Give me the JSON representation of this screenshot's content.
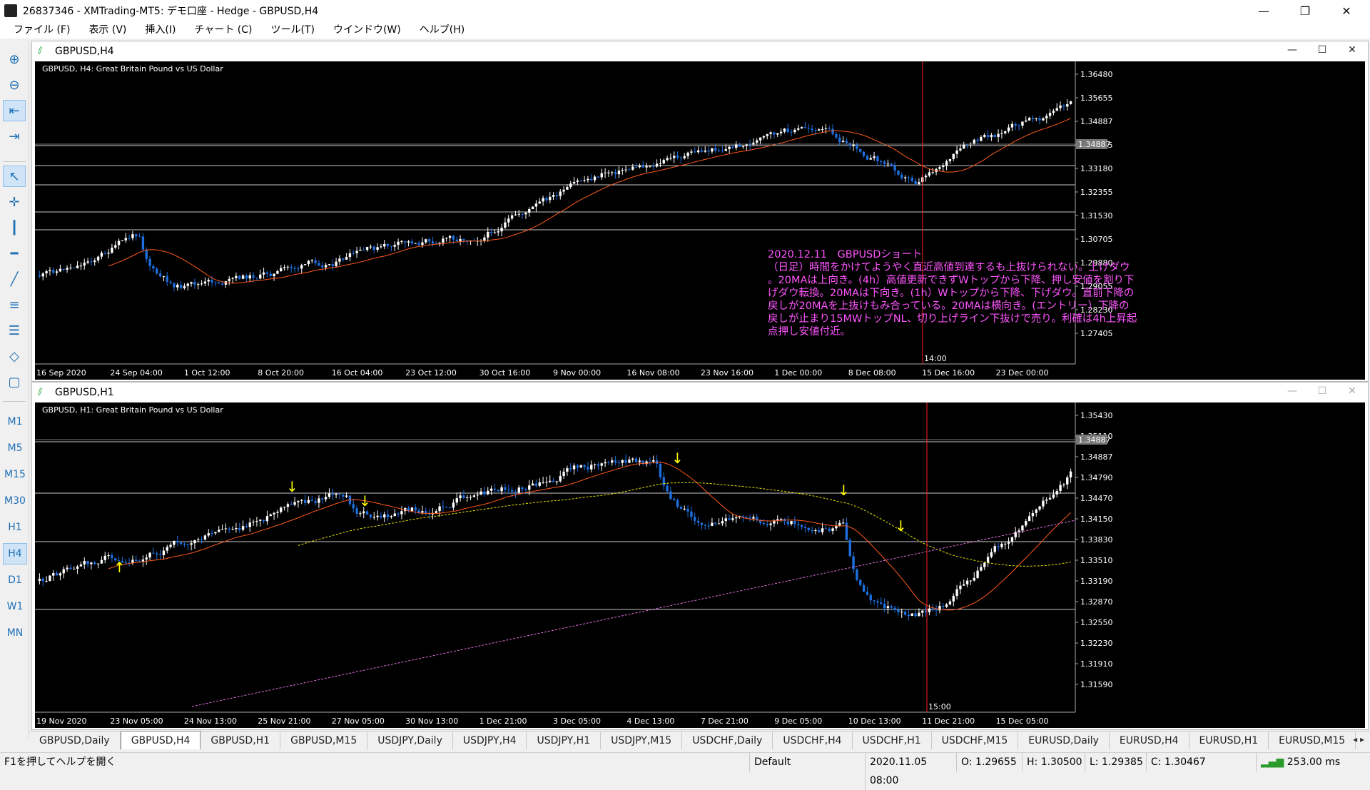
{
  "window": {
    "title": "26837346 - XMTrading-MT5: デモ口座 - Hedge - GBPUSD,H4",
    "controls": [
      "—",
      "❐",
      "✕"
    ]
  },
  "menu": [
    "ファイル (F)",
    "表示 (V)",
    "挿入(I)",
    "チャート (C)",
    "ツール(T)",
    "ウインドウ(W)",
    "ヘルプ(H)"
  ],
  "toolbar": {
    "tools": [
      "zoom-in-icon",
      "zoom-out-icon",
      "chart-shift-icon",
      "autoscroll-icon",
      "cursor-icon",
      "crosshair-icon",
      "vertical-line-icon",
      "horizontal-line-icon",
      "trend-line-icon",
      "channel-icon",
      "fibonacci-icon",
      "shapes-icon",
      "select-icon"
    ],
    "timeframes": [
      "M1",
      "M5",
      "M15",
      "M30",
      "H1",
      "H4",
      "D1",
      "W1",
      "MN"
    ],
    "active_timeframe": "H4"
  },
  "charts": [
    {
      "window_title": "GBPUSD,H4",
      "plot_label": "GBPUSD, H4:  Great Britain Pound vs US Dollar",
      "price_ticks": [
        "1.36480",
        "1.35655",
        "1.34887",
        "1.34005",
        "1.33180",
        "1.32355",
        "1.31530",
        "1.30705",
        "1.29880",
        "1.29055",
        "1.28230",
        "1.27405"
      ],
      "current_price": "1.34887",
      "time_ticks": [
        "16 Sep 2020",
        "24 Sep 04:00",
        "1 Oct 12:00",
        "8 Oct 20:00",
        "16 Oct 04:00",
        "23 Oct 12:00",
        "30 Oct 16:00",
        "9 Nov 00:00",
        "16 Nov 08:00",
        "23 Nov 16:00",
        "1 Dec 00:00",
        "8 Dec 08:00",
        "15 Dec 16:00",
        "23 Dec 00:00"
      ],
      "marker_time": "14:00",
      "note": "2020.12.11　GBPUSDショート\n（日足）時間をかけてようやく直近高値到達するも上抜けられない。上げダウ\n。20MAは上向き。(4h）高値更新できずWトップから下降、押し安値を割り下\nげダウ転換。20MAは下向き。(1h）Wトップから下降、下げダウ。直前下降の\n戻しが20MAを上抜けもみ合っている。20MAは横向き。(エントリー）下降の\n戻しが止まり15MWトップNL、切り上げライン下抜けで売り。利確は4h上昇起\n点押し安値付近。"
    },
    {
      "window_title": "GBPUSD,H1",
      "plot_label": "GBPUSD, H1:  Great Britain Pound vs US Dollar",
      "price_ticks": [
        "1.35430",
        "1.35110",
        "1.34887",
        "1.34790",
        "1.34470",
        "1.34150",
        "1.33830",
        "1.33510",
        "1.33190",
        "1.32870",
        "1.32550",
        "1.32230",
        "1.31910",
        "1.31590"
      ],
      "current_price": "1.34887",
      "time_ticks": [
        "19 Nov 2020",
        "23 Nov 05:00",
        "24 Nov 13:00",
        "25 Nov 21:00",
        "27 Nov 05:00",
        "30 Nov 13:00",
        "1 Dec 21:00",
        "3 Dec 05:00",
        "4 Dec 13:00",
        "7 Dec 21:00",
        "9 Dec 05:00",
        "10 Dec 13:00",
        "11 Dec 21:00",
        "15 Dec 05:00"
      ],
      "marker_time": "15:00"
    }
  ],
  "tabs": [
    "GBPUSD,Daily",
    "GBPUSD,H4",
    "GBPUSD,H1",
    "GBPUSD,M15",
    "USDJPY,Daily",
    "USDJPY,H4",
    "USDJPY,H1",
    "USDJPY,M15",
    "USDCHF,Daily",
    "USDCHF,H4",
    "USDCHF,H1",
    "USDCHF,M15",
    "EURUSD,Daily",
    "EURUSD,H4",
    "EURUSD,H1",
    "EURUSD,M15"
  ],
  "active_tab": "GBPUSD,H4",
  "tab_nav": "◂ ▸",
  "status": {
    "help": "F1を押してヘルプを開く",
    "profile": "Default",
    "datetime": "2020.11.05 08:00",
    "open": "O: 1.29655",
    "high": "H: 1.30500",
    "low": "L: 1.29385",
    "close": "C: 1.30467",
    "ping": "253.00 ms"
  },
  "colors": {
    "bull": "#ffffff",
    "bear": "#1e6fe0",
    "ma20": "#ff5a1a",
    "ma_slow": "#e5e500",
    "ma_long": "#e070e0",
    "note": "#ff55ff",
    "marker": "#ff2020",
    "arrow": "#ffff00"
  }
}
